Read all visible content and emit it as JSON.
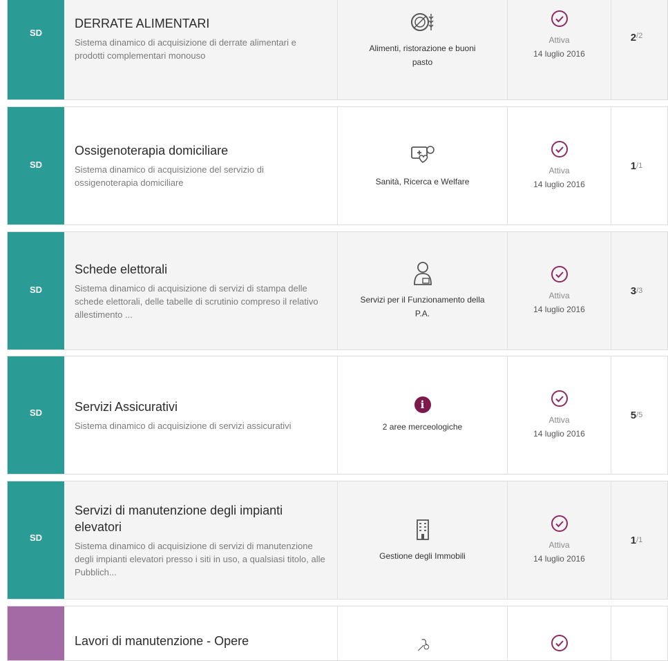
{
  "rows": [
    {
      "tag": "SD",
      "title": "DERRATE ALIMENTARI",
      "description": "Sistema dinamico di acquisizione di derrate alimentari e prodotti complementari monouso",
      "area_icon": "food-icon",
      "area_label": "Alimenti, ristorazione e buoni pasto",
      "status": "Attiva",
      "date": "14 luglio 2016",
      "count_current": "2",
      "count_total": "/2"
    },
    {
      "tag": "SD",
      "title": "Ossigenoterapia domiciliare",
      "description": "Sistema dinamico di acquisizione del servizio di ossigenoterapia domiciliare",
      "area_icon": "health-icon",
      "area_label": "Sanità, Ricerca e Welfare",
      "status": "Attiva",
      "date": "14 luglio 2016",
      "count_current": "1",
      "count_total": "/1"
    },
    {
      "tag": "SD",
      "title": "Schede elettorali",
      "description": "Sistema dinamico di acquisizione di servizi di stampa delle schede elettorali, delle tabelle di scrutinio compreso il relativo allestimento ...",
      "area_icon": "person-icon",
      "area_label": "Servizi per il Funzionamento della P.A.",
      "status": "Attiva",
      "date": "14 luglio 2016",
      "count_current": "3",
      "count_total": "/3"
    },
    {
      "tag": "SD",
      "title": "Servizi Assicurativi",
      "description": "Sistema dinamico di acquisizione di servizi assicurativi",
      "area_icon": "info-icon",
      "area_label": "2 aree merceologiche",
      "status": "Attiva",
      "date": "14 luglio 2016",
      "count_current": "5",
      "count_total": "/5"
    },
    {
      "tag": "SD",
      "title": "Servizi di manutenzione degli impianti elevatori",
      "description": "Sistema dinamico di acquisizione di servizi di manutenzione degli impianti elevatori presso i siti in uso, a qualsiasi titolo, alle Pubblich...",
      "area_icon": "building-icon",
      "area_label": "Gestione degli Immobili",
      "status": "Attiva",
      "date": "14 luglio 2016",
      "count_current": "1",
      "count_total": "/1"
    },
    {
      "tag": "",
      "title": "Lavori di manutenzione - Opere",
      "description": "",
      "area_icon": "tools-icon",
      "area_label": "",
      "status": "",
      "date": "",
      "count_current": "",
      "count_total": ""
    }
  ],
  "colors": {
    "tag_teal": "#2a9c95",
    "tag_purple": "#a36aa5",
    "status_accent": "#8e2a5f",
    "info_badge": "#7d1a4b"
  }
}
